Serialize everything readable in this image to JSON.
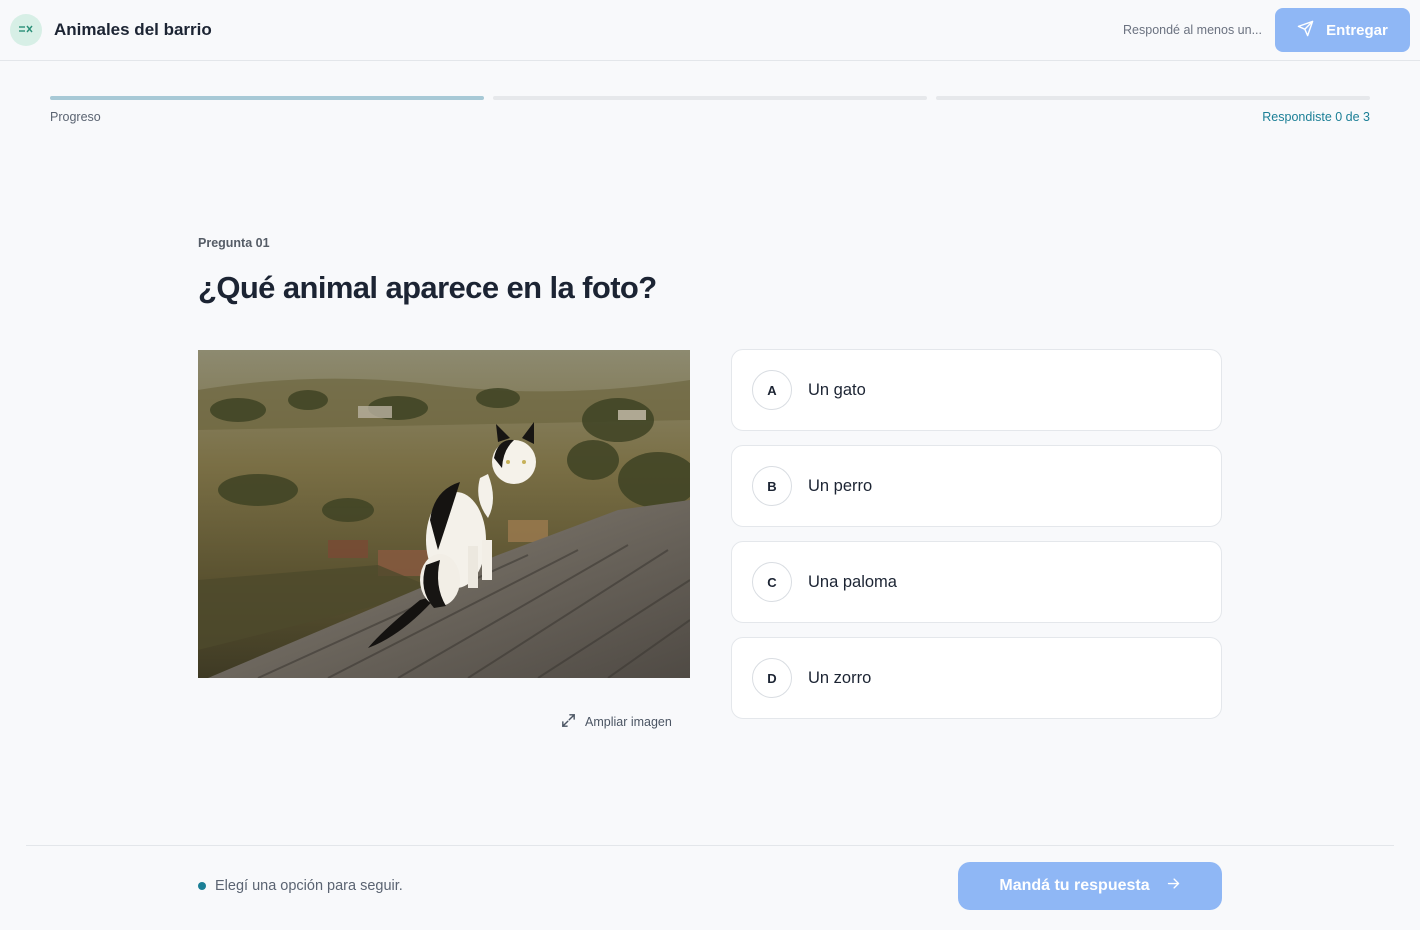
{
  "header": {
    "app_title": "Animales del barrio",
    "hint": "Respondé al menos un...",
    "submit_label": "Entregar",
    "app_icon": "checklist-icon",
    "submit_icon": "send-icon"
  },
  "progress": {
    "label": "Progreso",
    "count_text": "Respondiste 0 de 3",
    "segments_total": 3,
    "segments_done": 1
  },
  "question": {
    "number_label": "Pregunta 01",
    "title": "¿Qué animal aparece en la foto?",
    "expand_label": "Ampliar imagen",
    "expand_icon": "expand-icon"
  },
  "options": [
    {
      "letter": "A",
      "text": "Un gato"
    },
    {
      "letter": "B",
      "text": "Un perro"
    },
    {
      "letter": "C",
      "text": "Una paloma"
    },
    {
      "letter": "D",
      "text": "Un zorro"
    }
  ],
  "footer": {
    "status": "Elegí una opción para seguir.",
    "send_label": "Mandá tu respuesta",
    "send_icon": "arrow-right-icon"
  },
  "colors": {
    "accent": "#8fb7f5",
    "teal": "#1b7f96",
    "progress_done": "#a7c9d6"
  }
}
